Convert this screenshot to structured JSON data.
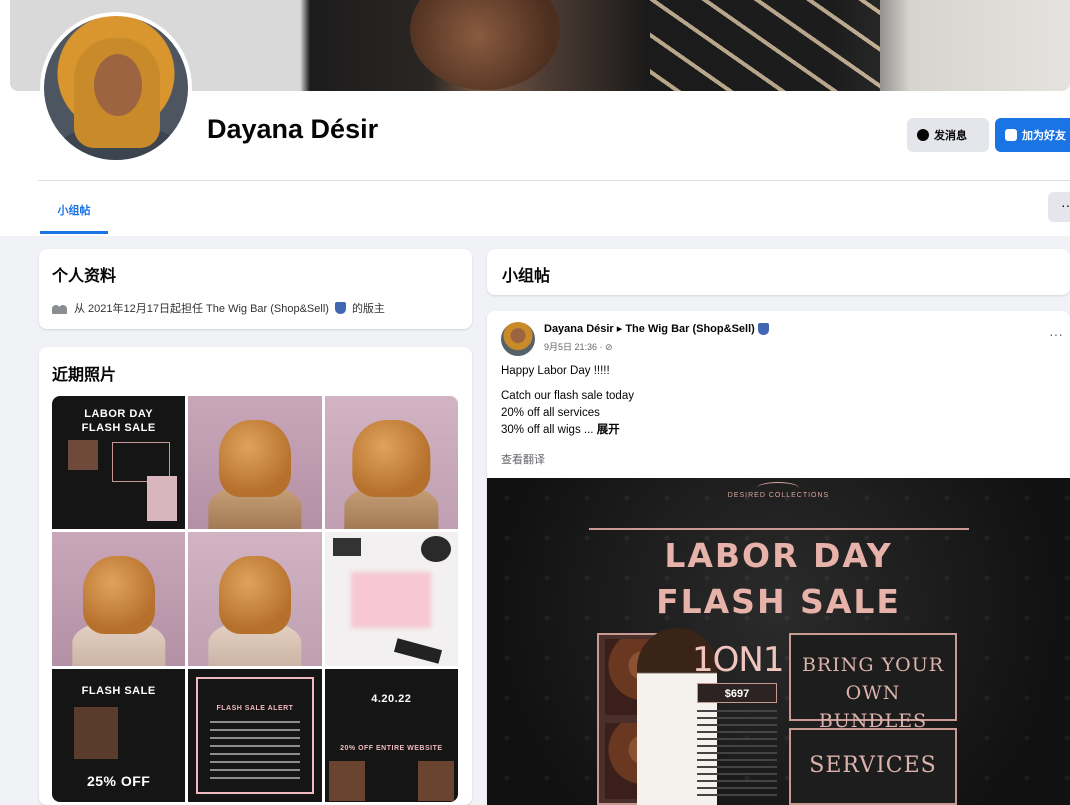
{
  "profile": {
    "name": "Dayana Désir",
    "message_button": "发消息",
    "add_friend_button": "加为好友",
    "tab": "小组帖",
    "more": "···"
  },
  "intro": {
    "title": "个人资料",
    "line": "从 2021年12月17日起担任 The Wig Bar (Shop&Sell)",
    "line_suffix": "的版主"
  },
  "photos": {
    "title": "近期照片",
    "tiles": [
      {
        "kind": "flyer",
        "caption_top": "LABOR DAY",
        "caption_bottom": "FLASH SALE"
      },
      {
        "kind": "wig"
      },
      {
        "kind": "wig"
      },
      {
        "kind": "wig"
      },
      {
        "kind": "wig"
      },
      {
        "kind": "promo"
      },
      {
        "kind": "flyer",
        "caption_top": "FLASH SALE",
        "caption_bottom": "25% OFF"
      },
      {
        "kind": "flyer",
        "caption_top": "FLASH SALE ALERT",
        "caption_bottom": ""
      },
      {
        "kind": "flyer",
        "caption_top": "4.20.22",
        "caption_bottom": "20% OFF ENTIRE WEBSITE"
      }
    ]
  },
  "feed": {
    "title": "小组帖"
  },
  "post": {
    "author": "Dayana Désir ▸ The Wig Bar (Shop&Sell)",
    "meta": "9月5日 21:36 · ⊘",
    "lines": [
      "Happy Labor Day !!!!!",
      "Catch our flash sale today",
      "20% off all services",
      "30% off all wigs ..."
    ],
    "see_more": "展开",
    "translate": "查看翻译",
    "flyer": {
      "brand": "DESIRED COLLECTIONS",
      "title_line1": "LABOR DAY",
      "title_line2": "FLASH SALE",
      "big_label": "1ON1",
      "price": "$697",
      "panel1_line1": "BRING YOUR",
      "panel1_line2": "OWN BUNDLES",
      "panel2": "SERVICES"
    }
  }
}
